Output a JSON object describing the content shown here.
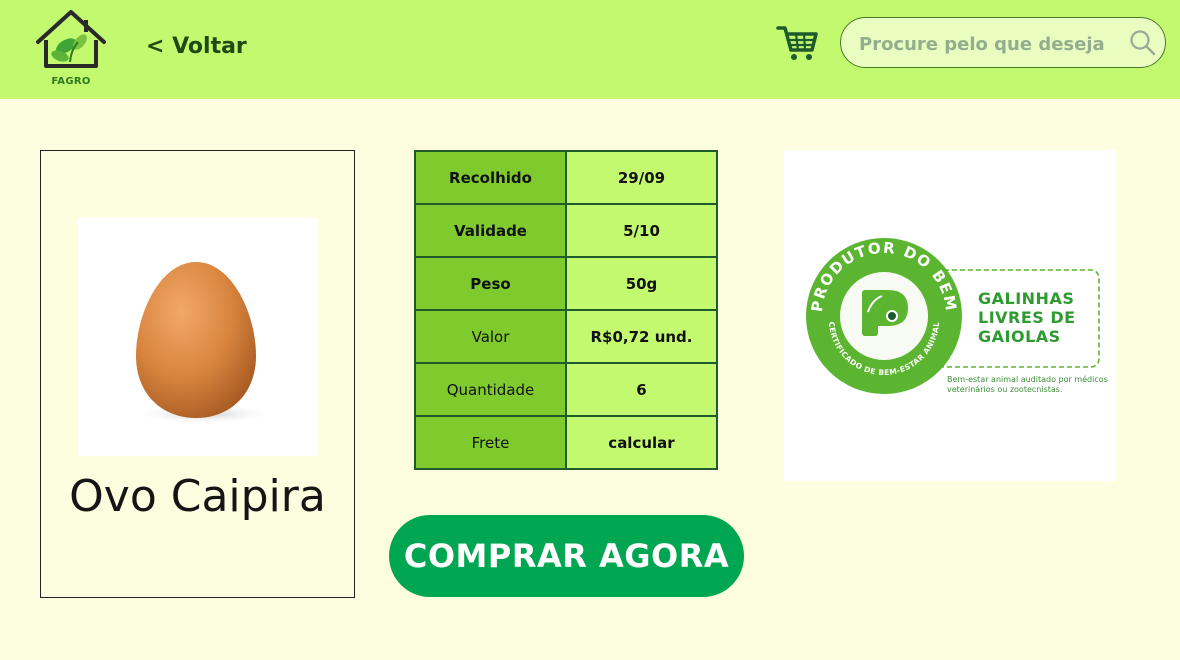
{
  "header": {
    "logo_text": "FAGRO",
    "back_label": "< Voltar",
    "search_placeholder": "Procure pelo que deseja"
  },
  "product": {
    "name": "Ovo Caipira"
  },
  "details": [
    {
      "label": "Recolhido",
      "value": "29/09"
    },
    {
      "label": "Validade",
      "value": "5/10"
    },
    {
      "label": "Peso",
      "value": "50g"
    },
    {
      "label": "Valor",
      "value": "R$0,72 und."
    },
    {
      "label": "Quantidade",
      "value": "6"
    },
    {
      "label": "Frete",
      "value": "calcular"
    }
  ],
  "buy_label": "COMPRAR AGORA",
  "certificate": {
    "arc_top": "PRODUTOR DO BEM",
    "arc_bottom": "CERTIFICADO DE BEM-ESTAR ANIMAL",
    "title": "GALINHAS LIVRES DE GAIOLAS",
    "note": "Bem-estar animal auditado por médicos veterinários ou zootecnistas."
  },
  "colors": {
    "header_bg": "#c3f96f",
    "page_bg": "#fdfde0",
    "button_bg": "#00a651",
    "table_label_bg": "#7fcb2e",
    "table_value_bg": "#c3f96f",
    "cert_green": "#5cb531"
  }
}
